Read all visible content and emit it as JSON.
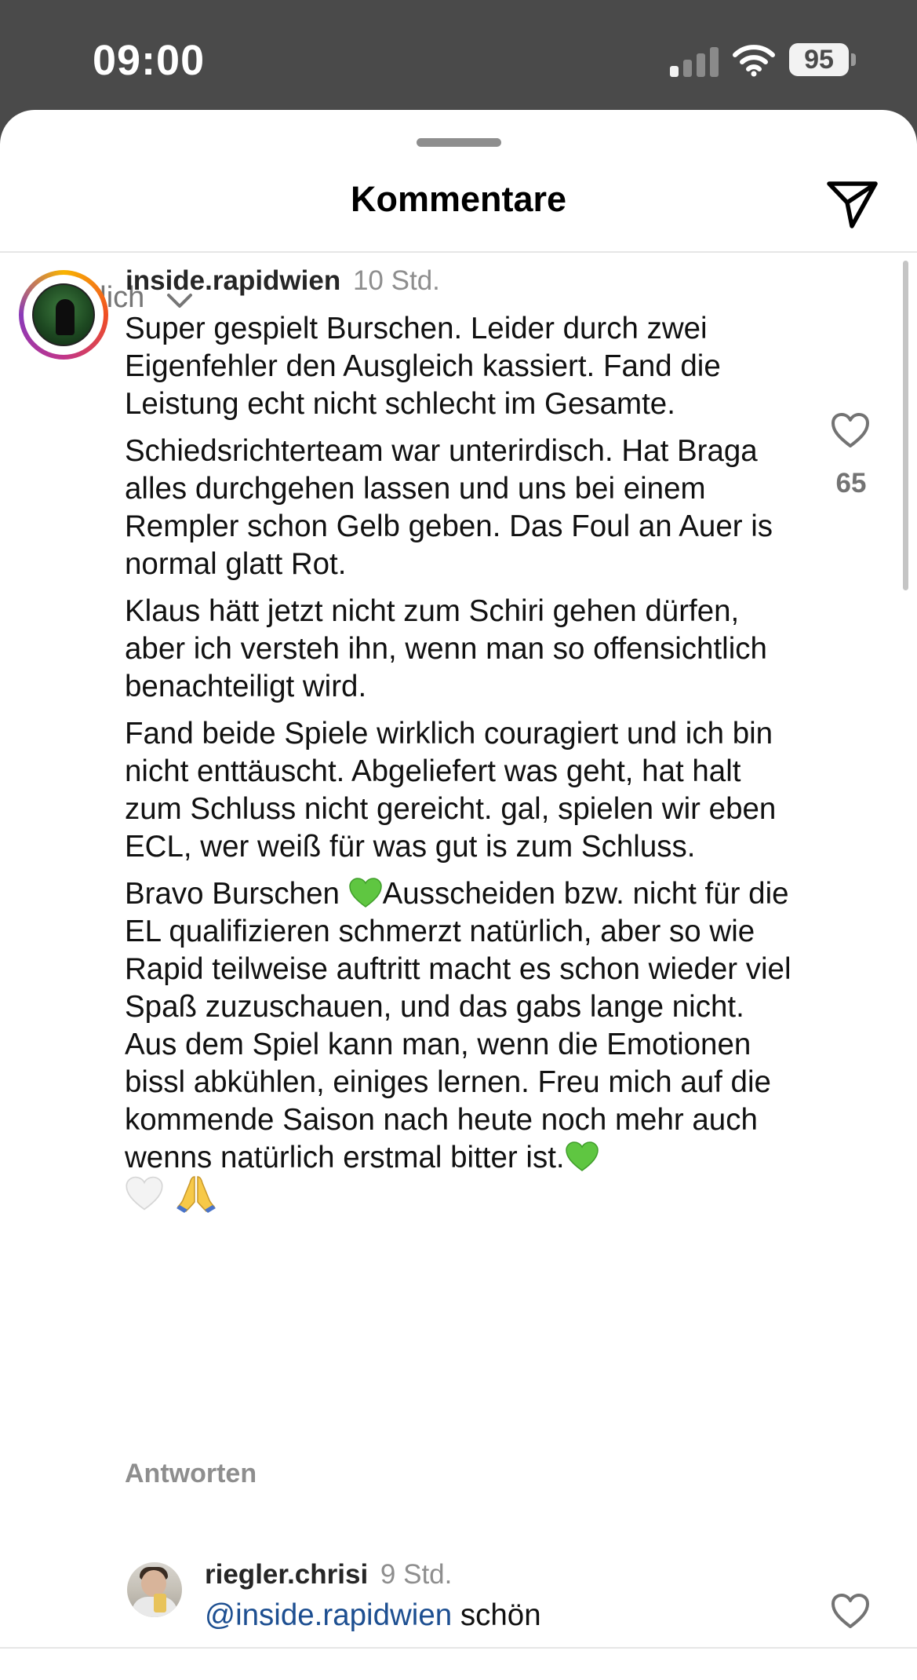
{
  "status_bar": {
    "time": "09:00",
    "battery": "95"
  },
  "sheet": {
    "title": "Kommentare"
  },
  "sort": {
    "label": "Für dich"
  },
  "comments": [
    {
      "user": "inside.rapidwien",
      "time": "10 Std.",
      "paragraphs": [
        "Super gespielt Burschen. Leider durch zwei Eigenfehler den Ausgleich kassiert. Fand die Leistung echt nicht schlecht im Gesamte.",
        "Schiedsrichterteam war unterirdisch. Hat Braga alles durchgehen lassen und uns bei einem Rempler schon Gelb geben. Das Foul an Auer is normal glatt Rot.",
        "Klaus hätt jetzt nicht zum Schiri gehen dürfen, aber ich versteh ihn, wenn man so offensichtlich benachteiligt wird.",
        "Fand beide Spiele wirklich couragiert und ich bin nicht enttäuscht. Abgeliefert was geht, hat halt zum Schluss nicht gereicht. gal, spielen wir eben ECL, wer weiß für was gut is zum Schluss."
      ],
      "last_paragraph_start": "Bravo Burschen ",
      "last_paragraph_rest": "Ausscheiden bzw. nicht für die EL qualifizieren schmerzt natürlich, aber so wie Rapid teilweise auftritt macht es schon wieder viel Spaß zuzuschauen, und das gabs lange nicht. Aus dem Spiel kann man, wenn die Emotionen bissl abkühlen, einiges lernen. Freu mich auf die kommende Saison nach heute noch mehr auch wenns natürlich erstmal bitter ist.",
      "likes": "65",
      "reply_label": "Antworten"
    },
    {
      "user": "riegler.chrisi",
      "time": "9 Std.",
      "mention": "@inside.rapidwien",
      "text": "schön"
    }
  ],
  "icons": {
    "send": "paper-plane-icon",
    "like": "heart-outline-icon",
    "sort": "chevron-down-icon",
    "emoji_green_heart": "green-heart-emoji",
    "emoji_white_heart": "white-heart-emoji",
    "emoji_pray": "folded-hands-emoji"
  },
  "colors": {
    "status_bar_bg": "#4a4a4a",
    "mention": "#1d4f91",
    "muted": "#8e8e8e"
  }
}
